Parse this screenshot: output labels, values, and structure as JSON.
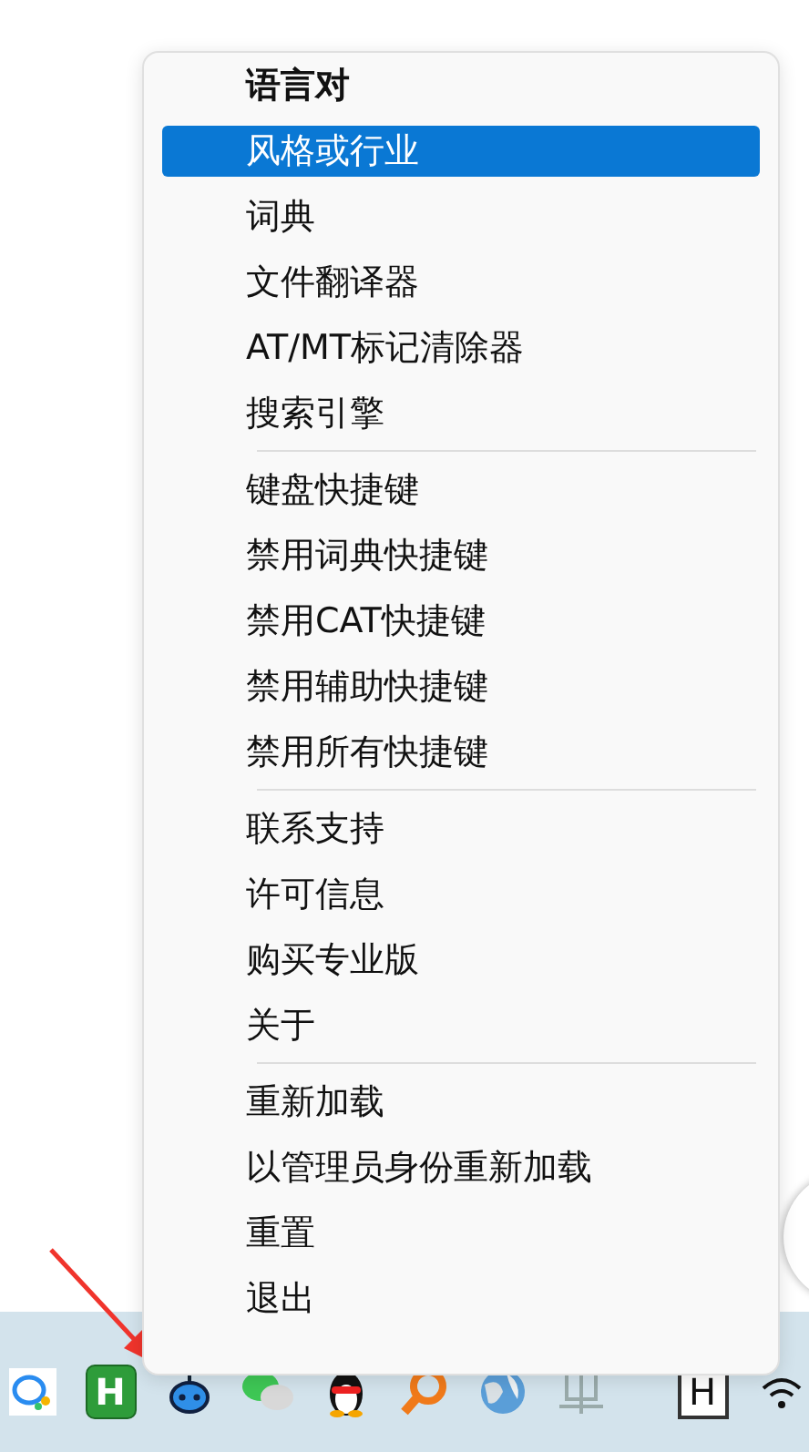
{
  "menu": {
    "items": [
      {
        "kind": "header",
        "label": "语言对",
        "selected": false
      },
      {
        "kind": "item",
        "label": "风格或行业",
        "selected": true
      },
      {
        "kind": "item",
        "label": "词典",
        "selected": false
      },
      {
        "kind": "item",
        "label": "文件翻译器",
        "selected": false
      },
      {
        "kind": "item",
        "label": "AT/MT标记清除器",
        "selected": false
      },
      {
        "kind": "item",
        "label": "搜索引擎",
        "selected": false
      },
      {
        "kind": "separator"
      },
      {
        "kind": "item",
        "label": "键盘快捷键",
        "selected": false
      },
      {
        "kind": "item",
        "label": "禁用词典快捷键",
        "selected": false
      },
      {
        "kind": "item",
        "label": "禁用CAT快捷键",
        "selected": false
      },
      {
        "kind": "item",
        "label": "禁用辅助快捷键",
        "selected": false
      },
      {
        "kind": "item",
        "label": "禁用所有快捷键",
        "selected": false
      },
      {
        "kind": "separator"
      },
      {
        "kind": "item",
        "label": "联系支持",
        "selected": false
      },
      {
        "kind": "item",
        "label": "许可信息",
        "selected": false
      },
      {
        "kind": "item",
        "label": "购买专业版",
        "selected": false
      },
      {
        "kind": "item",
        "label": "关于",
        "selected": false
      },
      {
        "kind": "separator"
      },
      {
        "kind": "item",
        "label": "重新加载",
        "selected": false
      },
      {
        "kind": "item",
        "label": "以管理员身份重新加载",
        "selected": false
      },
      {
        "kind": "item",
        "label": "重置",
        "selected": false
      },
      {
        "kind": "item",
        "label": "退出",
        "selected": false
      }
    ]
  },
  "taskbar": {
    "icons": [
      {
        "kind": "chat"
      },
      {
        "kind": "tile",
        "glyph": "H"
      },
      {
        "kind": "robot"
      },
      {
        "kind": "bubbles"
      },
      {
        "kind": "penguin"
      },
      {
        "kind": "magnifier"
      },
      {
        "kind": "globe"
      },
      {
        "kind": "keyboard"
      },
      {
        "kind": "boxed",
        "glyph": "H"
      },
      {
        "kind": "wifi"
      }
    ]
  }
}
